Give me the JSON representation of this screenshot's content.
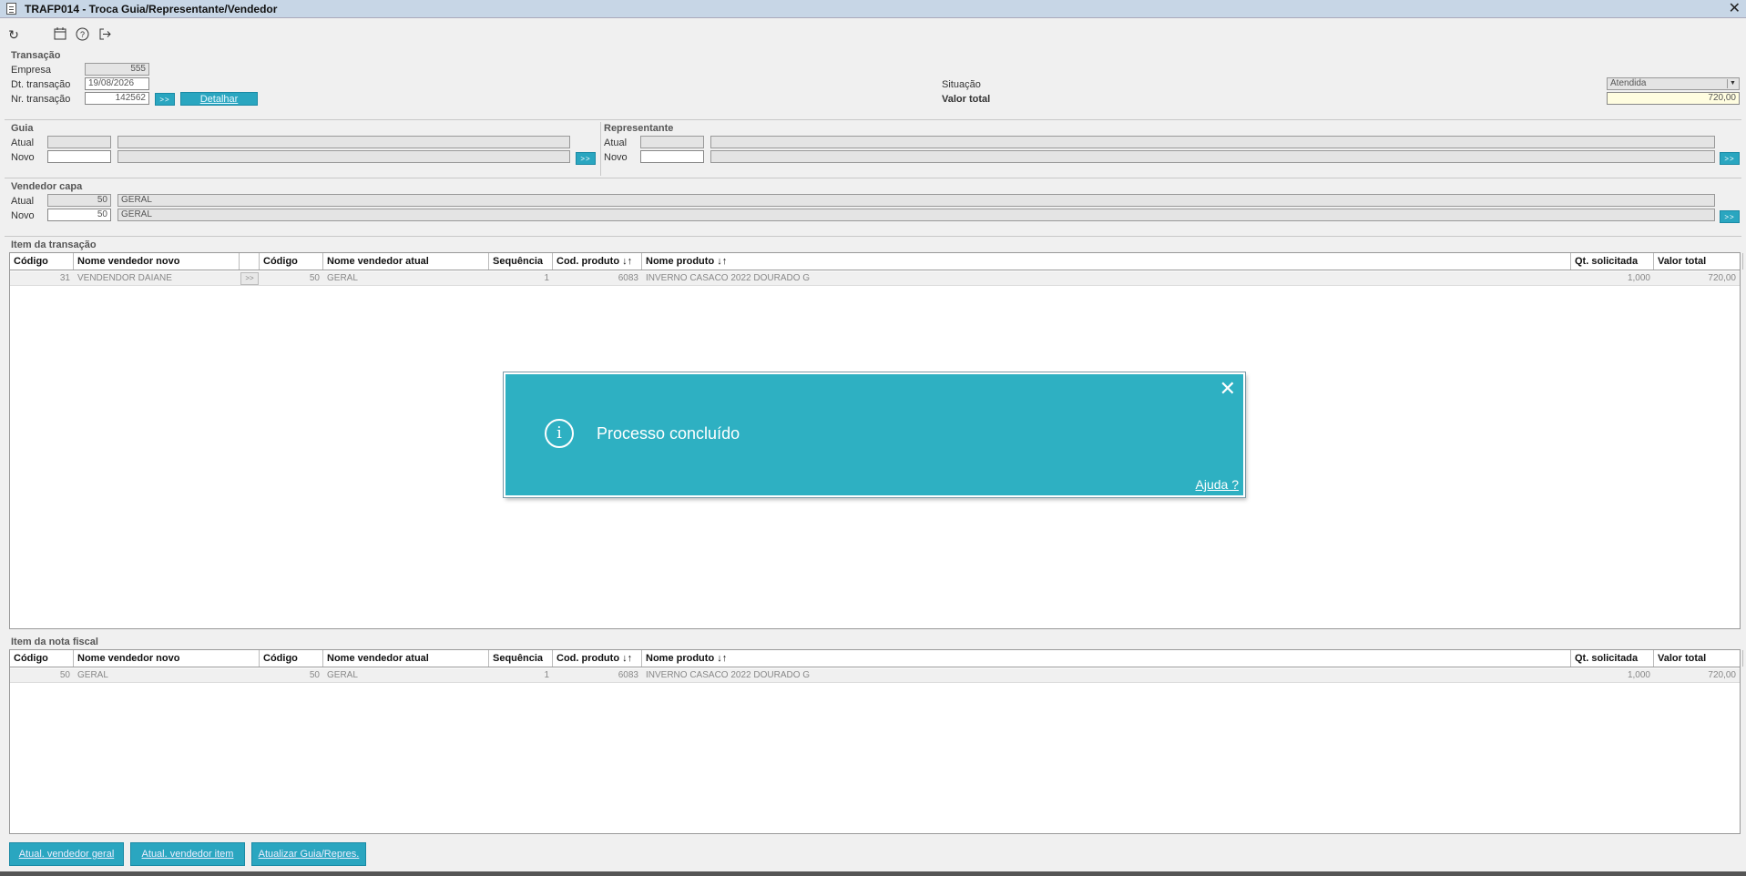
{
  "window": {
    "title": "TRAFP014 - Troca Guia/Representante/Vendedor"
  },
  "toolbar": {
    "icons": [
      "refresh-icon",
      "calendar-icon",
      "help-icon",
      "exit-icon"
    ]
  },
  "transacao": {
    "section": "Transação",
    "empresa_label": "Empresa",
    "empresa": "555",
    "dt_label": "Dt. transação",
    "dt": "19/08/2026",
    "nr_label": "Nr. transação",
    "nr": "142562",
    "arrow": ">>",
    "detalhar": "Detalhar",
    "situacao_label": "Situação",
    "situacao": "Atendida",
    "valor_label": "Valor total",
    "valor": "720,00"
  },
  "guia": {
    "section": "Guia",
    "atual_label": "Atual",
    "novo_label": "Novo",
    "atual_code": "",
    "atual_name": "",
    "novo_code": "",
    "novo_name": ""
  },
  "representante": {
    "section": "Representante",
    "atual_label": "Atual",
    "novo_label": "Novo",
    "atual_code": "",
    "atual_name": "",
    "novo_code": "",
    "novo_name": ""
  },
  "vendedor": {
    "section": "Vendedor capa",
    "atual_label": "Atual",
    "novo_label": "Novo",
    "atual_code": "50",
    "atual_name": "GERAL",
    "novo_code": "50",
    "novo_name": "GERAL"
  },
  "item_transacao": {
    "section": "Item da transação",
    "headers": [
      "Código",
      "Nome vendedor novo",
      "",
      "Código",
      "Nome vendedor atual",
      "Sequência",
      "Cod. produto ↓↑",
      "Nome produto ↓↑",
      "Qt. solicitada",
      "Valor total"
    ],
    "row": {
      "codigo_novo": "31",
      "nome_novo": "VENDENDOR DAIANE",
      "btn": ">>",
      "codigo_atual": "50",
      "nome_atual": "GERAL",
      "seq": "1",
      "cod_produto": "6083",
      "nome_produto": "INVERNO CASACO 2022 DOURADO G",
      "qt": "1,000",
      "valor": "720,00"
    }
  },
  "item_nf": {
    "section": "Item da nota fiscal",
    "headers": [
      "Código",
      "Nome vendedor novo",
      "Código",
      "Nome vendedor atual",
      "Sequência",
      "Cod. produto ↓↑",
      "Nome produto ↓↑",
      "Qt. solicitada",
      "Valor total"
    ],
    "row": {
      "codigo_novo": "50",
      "nome_novo": "GERAL",
      "codigo_atual": "50",
      "nome_atual": "GERAL",
      "seq": "1",
      "cod_produto": "6083",
      "nome_produto": "INVERNO CASACO 2022 DOURADO G",
      "qt": "1,000",
      "valor": "720,00"
    }
  },
  "buttons": {
    "geral": "Atual. vendedor geral",
    "item": "Atual. vendedor item",
    "guia": "Atualizar Guia/Repres."
  },
  "toast": {
    "message": "Processo concluído",
    "help": "Ajuda ?",
    "close": "✕",
    "info": "i"
  },
  "colors": {
    "accent": "#2aa6c0",
    "toast": "#2eb0c2",
    "titlebar": "#c7d6e6"
  }
}
